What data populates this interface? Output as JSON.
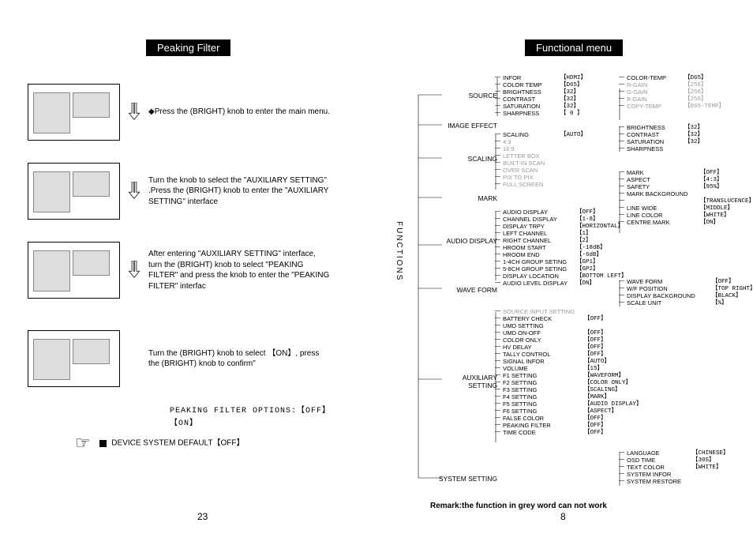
{
  "left": {
    "title": "Peaking Filter",
    "steps": [
      "◆Press the (BRIGHT) knob to enter the main menu.",
      "Turn the knob to select the \"AUXILIARY SETTING\" .Press the (BRIGHT) knob to enter the \"AUXILIARY SETTING\" interface",
      "After entering \"AUXILIARY SETTING\" interface, turn the (BRIGHT) knob to select \"PEAKING FILTER\" and press the knob to enter the \"PEAKING FILTER\" interfac",
      "Turn the (BRIGHT) knob to select 【ON】, press the (BRIGHT) knob to confirm\""
    ],
    "options_title": "PEAKING FILTER OPTIONS:【OFF】 【ON】",
    "default_line": "DEVICE SYSTEM DEFAULT【OFF】",
    "pagenum": "23"
  },
  "right": {
    "title": "Functional menu",
    "funclabel": "FUNCTIONS",
    "pagenum": "8",
    "remark": "Remark:the function in grey word  can not work",
    "cats": {
      "source": "SOURCE",
      "imageeffect": "IMAGE EFFECT",
      "scaling": "SCALING",
      "mark": "MARK",
      "audio": "AUDIO DISPLAY",
      "waveform": "WAVE FORM",
      "aux": "AUXILIARY SETTING",
      "system": "SYSTEM SETTING"
    },
    "source_items": [
      {
        "n": "INFOR",
        "v": "【HDMI】"
      },
      {
        "n": "COLOR TEMP",
        "v": "【D65】"
      },
      {
        "n": "BRIGHTNESS",
        "v": "【32】"
      },
      {
        "n": "CONTRAST",
        "v": "【32】"
      },
      {
        "n": "SATURATION",
        "v": "【32】"
      },
      {
        "n": "SHARPNESS",
        "v": "【 0 】"
      }
    ],
    "colortemp_items": [
      {
        "n": "COLOR-TEMP",
        "v": "【D65】"
      },
      {
        "n": "R-GAIN",
        "v": "【256】",
        "g": true
      },
      {
        "n": "G-GAIN",
        "v": "【256】",
        "g": true
      },
      {
        "n": "B-GAIN",
        "v": "【256】",
        "g": true
      },
      {
        "n": "COPY-TEMP",
        "v": "【D65-TEMP】",
        "g": true
      }
    ],
    "imageeffect_items": [
      {
        "n": "BRIGHTNESS",
        "v": "【32】"
      },
      {
        "n": "CONTRAST",
        "v": "【32】"
      },
      {
        "n": "SATURATION",
        "v": "【32】"
      },
      {
        "n": "SHARPNESS",
        "v": ""
      }
    ],
    "scaling_items": [
      {
        "n": "SCALING",
        "v": "【AUTO】"
      },
      {
        "n": "4:3",
        "g": true
      },
      {
        "n": "16:9",
        "g": true
      },
      {
        "n": "LETTER BOX",
        "g": true
      },
      {
        "n": "BUILT-IN SCAN",
        "g": true
      },
      {
        "n": "OVER SCAN",
        "g": true
      },
      {
        "n": "PIX TO PIX",
        "g": true
      },
      {
        "n": "FULL SCREEN",
        "g": true
      }
    ],
    "mark_items": [
      {
        "n": "MARK",
        "v": "【OFF】"
      },
      {
        "n": "ASPECT",
        "v": "【4:3】"
      },
      {
        "n": "SAFETY",
        "v": "【95%】"
      },
      {
        "n": "MARK BACKGROUND",
        "v": ""
      },
      {
        "n": "",
        "v": "【TRANSLUCENCE】"
      },
      {
        "n": "LINE WIDE",
        "v": "【MIDDLE】"
      },
      {
        "n": "LINE COLOR",
        "v": "【WHITE】"
      },
      {
        "n": "CENTRE MARK",
        "v": "【ON】"
      }
    ],
    "audio_items": [
      {
        "n": "AUDIO DISPLAY",
        "v": "【OFF】"
      },
      {
        "n": "CHANNEL DISPLAY",
        "v": "【1-8】"
      },
      {
        "n": "DISPLAY TRPY",
        "v": "【HORIZONTAL】"
      },
      {
        "n": "LEFT CHANNEL",
        "v": "【1】"
      },
      {
        "n": "RIGHT CHANNEL",
        "v": "【2】"
      },
      {
        "n": "HROOM START",
        "v": "【-18dB】"
      },
      {
        "n": "HROOM END",
        "v": "【-6dB】"
      },
      {
        "n": "1-4CH GROUP SETING",
        "v": "【GP1】"
      },
      {
        "n": "5-8CH GROUP SETING",
        "v": "【GP2】"
      },
      {
        "n": "DISPLAY LOCATION",
        "v": "【BOTTOM LEFT】"
      },
      {
        "n": "AUDIO LEVEL DISPLAY",
        "v": "【ON】"
      }
    ],
    "waveform_items": [
      {
        "n": "WAVE FORM",
        "v": "【OFF】"
      },
      {
        "n": "W/F POSITION",
        "v": "【TOP RIGHT】"
      },
      {
        "n": "DISPLAY BACKGROUND",
        "v": "【BLACK】"
      },
      {
        "n": "SCALE UNIT",
        "v": "【%】"
      }
    ],
    "aux_items": [
      {
        "n": "SOURCE INPUT SETTING",
        "g": true
      },
      {
        "n": "BATTERY CHECK",
        "v": "【OFF】"
      },
      {
        "n": "UMD SETTING"
      },
      {
        "n": "UMD ON-OFF",
        "v": "【OFF】"
      },
      {
        "n": "COLOR ONLY",
        "v": "【OFF】"
      },
      {
        "n": "HV DELAY",
        "v": "【OFF】"
      },
      {
        "n": "TALLY CONTROL",
        "v": "【OFF】"
      },
      {
        "n": "SIGNAL INFOR",
        "v": "【AUTO】"
      },
      {
        "n": "VOLUME",
        "v": "【15】"
      },
      {
        "n": "F1 SETTING",
        "v": "【WAVEFORM】"
      },
      {
        "n": "F2 SETTING",
        "v": "【COLOR ONLY】"
      },
      {
        "n": "F3 SETTING",
        "v": "【SCALING】"
      },
      {
        "n": "F4 SETTING",
        "v": "【MARK】"
      },
      {
        "n": "F5 SETTING",
        "v": "【AUDIO DISPLAY】"
      },
      {
        "n": "F6 SETTING",
        "v": "【ASPECT】"
      },
      {
        "n": "FALSE COLOR",
        "v": "【OFF】"
      },
      {
        "n": "PEAKING FILTER",
        "v": "【OFF】"
      },
      {
        "n": "TIME CODE",
        "v": "【OFF】"
      }
    ],
    "system_items": [
      {
        "n": "LANGUAGE",
        "v": "【CHINESE】"
      },
      {
        "n": "OSD TIME",
        "v": "【30S】"
      },
      {
        "n": "TEXT COLOR",
        "v": "【WHITE】"
      },
      {
        "n": "SYSTEM INFOR"
      },
      {
        "n": "SYSTEM RESTORE"
      }
    ]
  }
}
